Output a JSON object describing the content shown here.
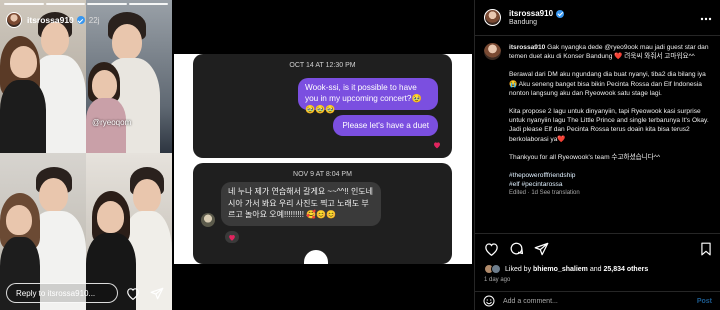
{
  "story": {
    "username": "itsrossa910",
    "time_ago": "22j",
    "photo_handle": "@ryeoqom",
    "reply_placeholder": "Reply to itsrossa910...",
    "progress_bars": 4
  },
  "chat": {
    "card1": {
      "date": "OCT 14 AT 12:30 PM",
      "message1": "Wook-ssi, is it possible to have you in my upcoming concert?🥹🥹🥹🥹",
      "message2": "Please let's have a duet"
    },
    "card2": {
      "date": "NOV 9 AT 8:04 PM",
      "message": "네 누나 제가 연습해서 갈게요 ~~^^!! 인도네시아 가서 봐요 우리 사진도 찍고 노래도 부르고 놀아요 오예!!!!!!!!! 🥰😊😊"
    }
  },
  "post": {
    "username": "itsrossa910",
    "location": "Bandung",
    "caption": {
      "intro": "Gak nyangka dede @ryeo9ook mau jadi guest star dan temen duet aku di Konser Bandung ❤️ 려욱씨 와줘서 고마워요^^",
      "para2": "Berawal dari DM aku ngundang dia buat nyanyi, tiba2 dia bilang iya😭 Aku seneng banget bisa bikin Pecinta Rossa dan Elf Indonesia nonton langsung aku dan Ryeowook satu stage lagi.",
      "para3": "Kita propose 2 lagu untuk dinyanyiin, tapi Ryeowook kasi surprise untuk nyanyiin lagu The Little Prince and single terbarunya It's Okay. Jadi please Elf dan Pecinta Rossa terus doain kita bisa terus2 berkolaborasi ya❤️",
      "para4": "Thankyou for all Ryeowook's team 수고하셨습니다^^",
      "hashtags1": "#thepowerofffriendship",
      "hashtags2": "#elf #pecintarossa",
      "meta": "Edited · 1d   See translation"
    },
    "likes": {
      "prefix": "Liked by ",
      "user": "bhiemo_shaliem",
      "middle": " and ",
      "count": "25,834 others"
    },
    "time_ago": "1 day ago",
    "comment_placeholder": "Add a comment...",
    "post_button": "Post"
  },
  "colors": {
    "chat_purple": "#7b4fe0",
    "chat_card": "#1f1f1f",
    "verified_blue": "#3897f0"
  }
}
